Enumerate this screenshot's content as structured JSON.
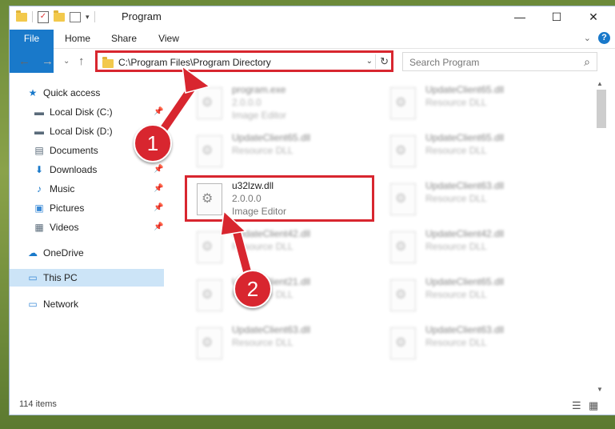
{
  "window": {
    "title": "Program",
    "minimize": "—",
    "maximize": "☐",
    "close": "✕"
  },
  "ribbon": {
    "tabs": [
      "File",
      "Home",
      "Share",
      "View"
    ],
    "collapse": "⌄",
    "help": "?"
  },
  "nav": {
    "back": "←",
    "forward": "→",
    "dropdown": "⌄",
    "up": "↑"
  },
  "address": {
    "path": "C:\\Program Files\\Program Directory",
    "dropdown": "⌄",
    "refresh": "↻"
  },
  "search": {
    "placeholder": "Search Program",
    "icon": "⌕"
  },
  "sidebar": {
    "items": [
      {
        "label": "Quick access",
        "icon": "★",
        "color": "#1979ca"
      },
      {
        "label": "Local Disk (C:)",
        "icon": "▬",
        "color": "#5a6b7a"
      },
      {
        "label": "Local Disk (D:)",
        "icon": "▬",
        "color": "#5a6b7a"
      },
      {
        "label": "Documents",
        "icon": "▤",
        "color": "#5a6b7a"
      },
      {
        "label": "Downloads",
        "icon": "⬇",
        "color": "#1979ca"
      },
      {
        "label": "Music",
        "icon": "♪",
        "color": "#1979ca"
      },
      {
        "label": "Pictures",
        "icon": "▣",
        "color": "#3a8ad6"
      },
      {
        "label": "Videos",
        "icon": "▦",
        "color": "#5a6b7a"
      },
      {
        "label": "OneDrive",
        "icon": "☁",
        "color": "#1979ca"
      },
      {
        "label": "This PC",
        "icon": "▭",
        "color": "#3a8ad6"
      },
      {
        "label": "Network",
        "icon": "▭",
        "color": "#3a8ad6"
      }
    ],
    "pin": "📌"
  },
  "files": [
    {
      "name": "program.exe",
      "version": "2.0.0.0",
      "type": "Image Editor"
    },
    {
      "name": "UpdateClient65.dll",
      "version": "",
      "type": "Resource DLL"
    },
    {
      "name": "UpdateClient65.dll",
      "version": "",
      "type": "Resource DLL"
    },
    {
      "name": "UpdateClient65.dll",
      "version": "",
      "type": "Resource DLL"
    },
    {
      "name": "u32lzw.dll",
      "version": "2.0.0.0",
      "type": "Image Editor"
    },
    {
      "name": "UpdateClient63.dll",
      "version": "",
      "type": "Resource DLL"
    },
    {
      "name": "UpdateClient42.dll",
      "version": "",
      "type": "Resource DLL"
    },
    {
      "name": "UpdateClient42.dll",
      "version": "",
      "type": "Resource DLL"
    },
    {
      "name": "UpdateClient21.dll",
      "version": "",
      "type": "Resource DLL"
    },
    {
      "name": "UpdateClient65.dll",
      "version": "",
      "type": "Resource DLL"
    },
    {
      "name": "UpdateClient63.dll",
      "version": "",
      "type": "Resource DLL"
    },
    {
      "name": "UpdateClient63.dll",
      "version": "",
      "type": "Resource DLL"
    }
  ],
  "status": {
    "count": "114 items"
  },
  "annotations": {
    "step1": "1",
    "step2": "2",
    "accent": "#d8262f"
  }
}
